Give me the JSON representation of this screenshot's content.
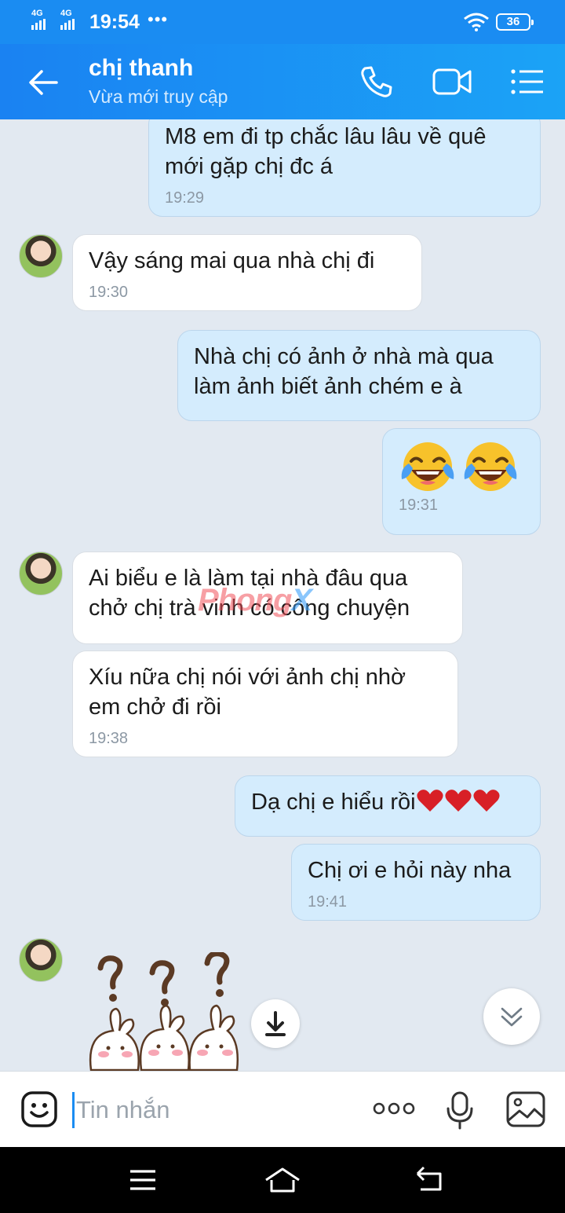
{
  "status_bar": {
    "network_1": "4G",
    "network_2": "4G",
    "time": "19:54",
    "dots": "•••",
    "battery": "36"
  },
  "header": {
    "contact_name": "chị thanh",
    "contact_status": "Vừa mới truy cập"
  },
  "messages": [
    {
      "side": "out",
      "text": "M8 em đi tp chắc lâu lâu về quê\nmới gặp chị đc á",
      "time": "19:29"
    },
    {
      "side": "in",
      "text": "Vậy sáng mai qua nhà chị đi",
      "time": "19:30"
    },
    {
      "side": "out",
      "text": "Nhà chị có ảnh ở nhà mà qua\nlàm ảnh biết ảnh chém e à",
      "time": ""
    },
    {
      "side": "out",
      "emoji": [
        "face-with-tears-of-joy-icon",
        "face-with-tears-of-joy-icon"
      ],
      "time": "19:31"
    },
    {
      "side": "in",
      "text": "Ai biểu e là làm tại nhà đâu qua\nchở chị trà vinh có công chuyện",
      "time": ""
    },
    {
      "side": "in",
      "text": "Xíu nữa chị nói với ảnh  chị nhờ\nem chở đi rồi",
      "time": "19:38"
    },
    {
      "side": "out",
      "text": "Dạ chị e hiểu rồi",
      "hearts": 3,
      "time": ""
    },
    {
      "side": "out",
      "text": "Chị ơi e hỏi này nha",
      "time": "19:41"
    }
  ],
  "watermark": {
    "part1": "Phong",
    "part2": "X"
  },
  "input_bar": {
    "placeholder": "Tin nhắn",
    "more_label": "ooo"
  },
  "icons": {
    "back": "arrow-left-icon",
    "call": "phone-icon",
    "video": "video-camera-icon",
    "menu": "list-menu-icon",
    "sticker": "smiley-icon",
    "mic": "microphone-icon",
    "image": "image-icon",
    "download": "download-icon",
    "scroll_down": "double-chevron-down-icon"
  },
  "colors": {
    "header_start": "#1a82f2",
    "header_end": "#1ba3f6",
    "outgoing_bubble": "#d4ecfd",
    "incoming_bubble": "#ffffff",
    "chat_background": "#e2e9f1"
  }
}
